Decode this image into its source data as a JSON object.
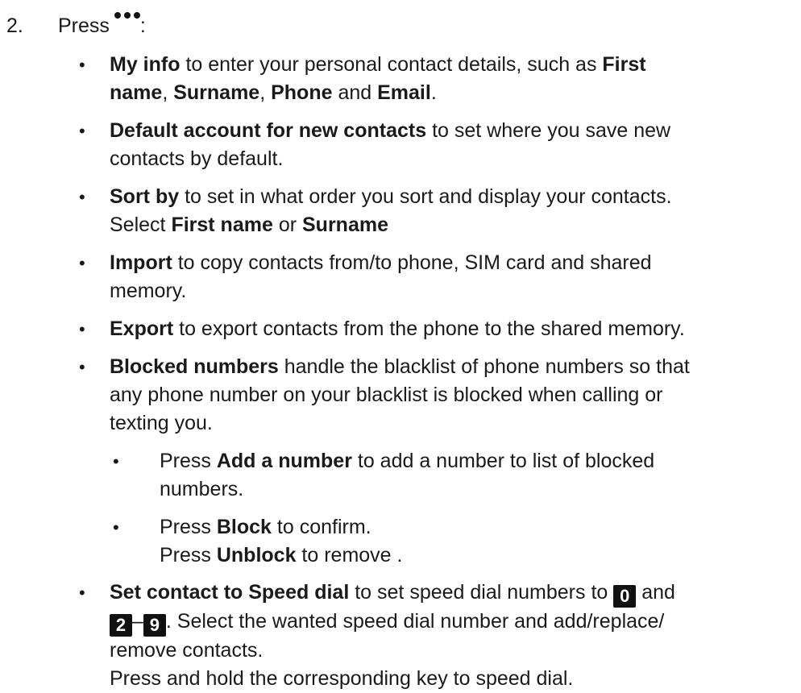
{
  "step": {
    "number": "2.",
    "press_label": "Press",
    "icon": "menu-dots-icon",
    "colon": ":"
  },
  "items": [
    {
      "segments": [
        "My info",
        " to enter your personal contact details, such as ",
        "First",
        " ",
        "name",
        ", ",
        "Surname",
        ", ",
        "Phone",
        " and ",
        "Email",
        "."
      ]
    },
    {
      "segments": [
        "Default account for new contacts",
        " to set where you save new",
        "contacts by default."
      ]
    },
    {
      "segments": [
        "Sort by",
        " to set in what order you sort and display your contacts.",
        "Select ",
        "First name",
        " or ",
        "Surname"
      ]
    },
    {
      "segments": [
        "Import",
        " to copy contacts from/to phone, SIM card and shared",
        "memory."
      ]
    },
    {
      "segments": [
        "Export",
        " to export contacts from the phone to the shared memory."
      ]
    },
    {
      "segments": [
        "Blocked numbers",
        " handle the blacklist of phone numbers so that",
        "any phone number on your blacklist is blocked when calling or",
        "texting you."
      ]
    }
  ],
  "sub_items": [
    {
      "segments": [
        "Press ",
        "Add a number",
        " to add a number to list of blocked",
        "numbers."
      ]
    },
    {
      "segments": [
        "Press ",
        "Block",
        " to confirm.",
        "Press ",
        "Unblock",
        " to remove ."
      ]
    }
  ],
  "speed_dial": {
    "lead": "Set contact to Speed dial",
    "text1": " to set speed dial numbers to ",
    "key_zero": "0",
    "and": " and",
    "key_two": "2",
    "dash": "–",
    "key_nine": "9",
    "text2": ". Select the wanted speed dial number and add/replace/",
    "text3": "remove contacts.",
    "text4": "Press and hold the corresponding key to speed dial."
  },
  "bullet_char": "•"
}
